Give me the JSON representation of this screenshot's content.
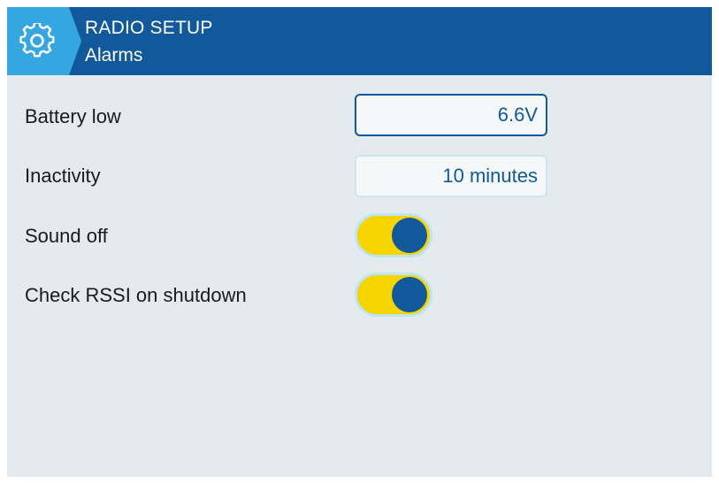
{
  "header": {
    "title": "RADIO SETUP",
    "subtitle": "Alarms",
    "icon": "gear-icon"
  },
  "settings": [
    {
      "label": "Battery low",
      "type": "number",
      "value": "6.6V"
    },
    {
      "label": "Inactivity",
      "type": "number",
      "value": "10 minutes"
    },
    {
      "label": "Sound off",
      "type": "toggle",
      "checked": true
    },
    {
      "label": "Check RSSI on shutdown",
      "type": "toggle",
      "checked": true
    }
  ],
  "colors": {
    "header": "#11599a",
    "background": "#e3ebef",
    "accent": "#11599a",
    "toggle_on": "#f5d400",
    "field_bg": "#f4f8f8"
  }
}
